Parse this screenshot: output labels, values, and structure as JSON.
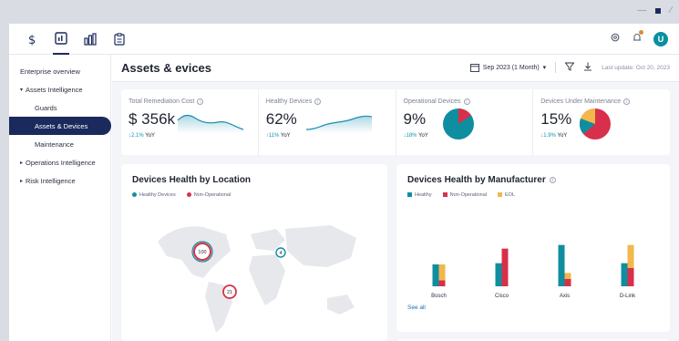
{
  "window": {
    "minimize_glyph": "—",
    "expand_glyph": "⁄"
  },
  "topbar": {
    "icons": [
      "dollar-icon",
      "dashboard-icon",
      "bar-chart-icon",
      "clipboard-icon"
    ],
    "right_icons": [
      "settings-icon",
      "notifications-icon"
    ],
    "avatar_initial": "U"
  },
  "sidebar": {
    "items": [
      {
        "label": "Enterprise overview"
      },
      {
        "label": "Assets Intelligence",
        "caret": "▾"
      },
      {
        "label": "Guards"
      },
      {
        "label": "Assets & Devices"
      },
      {
        "label": "Maintenance"
      },
      {
        "label": "Operations Intelligence",
        "caret": "▸"
      },
      {
        "label": "Risk Intelligence",
        "caret": "▸"
      }
    ]
  },
  "header": {
    "title": "Assets & evices",
    "date_range": "Sep 2023 (1 Month)",
    "date_caret": "▾",
    "last_update": "Last update: Oct 20, 2023"
  },
  "kpis": [
    {
      "label": "Total Remediation Cost",
      "value": "$ 356k",
      "delta": "2.1%",
      "delta_arrow": "↓",
      "delta_suffix": "YoY"
    },
    {
      "label": "Healthy Devices",
      "value": "62%",
      "delta": "11%",
      "delta_arrow": "↑",
      "delta_suffix": "YoY"
    },
    {
      "label": "Operational Devices",
      "value": "9%",
      "delta": "18%",
      "delta_arrow": "↓",
      "delta_suffix": "YoY"
    },
    {
      "label": "Devices Under Maintenance",
      "value": "15%",
      "delta": "1.9%",
      "delta_arrow": "↓",
      "delta_suffix": "YoY"
    }
  ],
  "location_card": {
    "title": "Devices Health by Location",
    "legend": [
      "Healthy Devices",
      "Non-Operational"
    ],
    "bubbles": [
      "100",
      "4",
      "21"
    ]
  },
  "manufacturer_card": {
    "title": "Devices Health by Manufacturer",
    "legend": [
      "Healthy",
      "Non-Operational",
      "EOL"
    ],
    "see_all": "See all"
  },
  "colors": {
    "healthy": "#0f8ea0",
    "non_operational": "#d8304a",
    "eol": "#f2b84b",
    "nav": "#1b2a5c"
  },
  "chart_data": {
    "type": "bar",
    "categories": [
      "Bosch",
      "Cisco",
      "Axis",
      "D-Link"
    ],
    "series": [
      {
        "name": "Healthy",
        "values": [
          18,
          19,
          34,
          19
        ]
      },
      {
        "name": "Non-Operational",
        "values": [
          5,
          31,
          6,
          15
        ]
      },
      {
        "name": "EOL",
        "values": [
          13,
          0,
          5,
          19
        ]
      }
    ],
    "ylim": [
      0,
      60
    ]
  }
}
